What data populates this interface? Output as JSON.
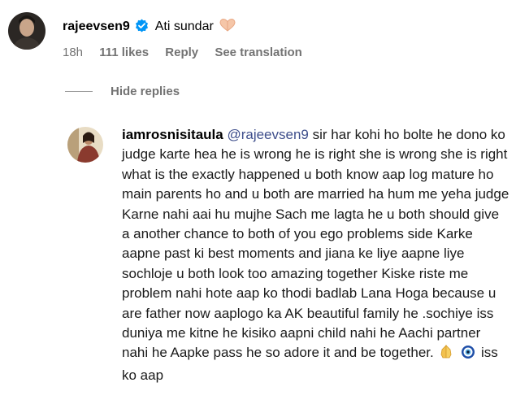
{
  "comment": {
    "username": "rajeevsen9",
    "text": "Ati sundar",
    "time": "18h",
    "likes": "111 likes",
    "reply_label": "Reply",
    "translate_label": "See translation",
    "icons": [
      "verified-badge-icon",
      "heart-hands-emoji-icon"
    ]
  },
  "thread": {
    "hide_replies_label": "Hide replies"
  },
  "reply": {
    "username": "iamrosnisitaula",
    "mention": "@rajeevsen9",
    "body": "sir har kohi ho bolte he dono ko judge karte hea he is wrong he is right she is wrong she is right what is the exactly happened u both know aap log mature ho main parents ho and u both are married ha hum me yeha judge Karne nahi aai hu mujhe Sach me lagta he u both should give a another chance to both of you ego problems side Karke aapne past ki best moments and jiana ke liye aapne liye sochloje u both look too amazing together Kiske riste me problem nahi hote aap ko thodi badlab Lana Hoga because u are father now aaplogo ka AK beautiful family he .sochiye iss duniya me kitne he kisiko aapni child nahi he Aachi partner nahi he Aapke pass he so adore it and be together.",
    "tail": "iss ko aap",
    "icons": [
      "praying-hands-emoji-icon",
      "nazar-amulet-emoji-icon"
    ]
  },
  "colors": {
    "meta_gray": "#737373",
    "verified_blue": "#0095f6",
    "mention_blue": "#3f4f8c"
  }
}
